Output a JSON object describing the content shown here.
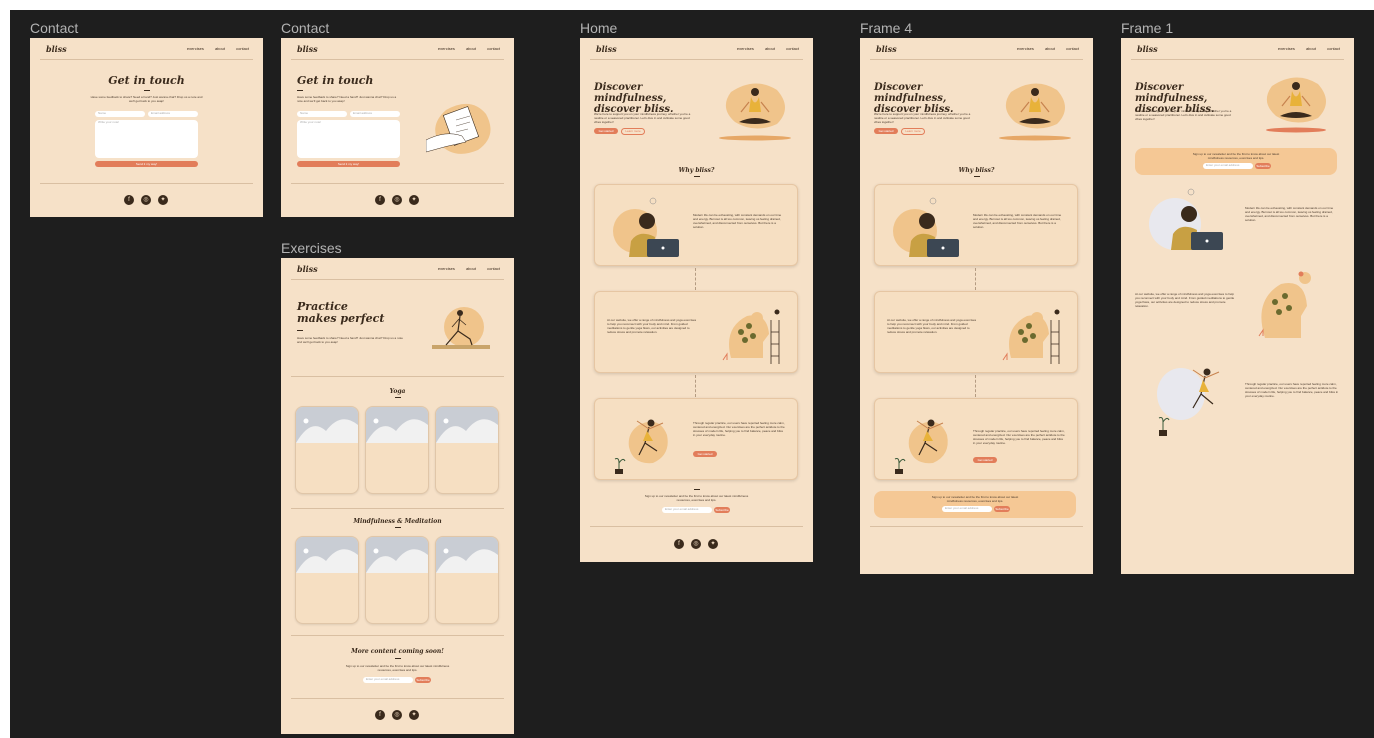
{
  "frames": {
    "contact1": {
      "label": "Contact"
    },
    "contact2": {
      "label": "Contact"
    },
    "exercises": {
      "label": "Exercises"
    },
    "home": {
      "label": "Home"
    },
    "frame4": {
      "label": "Frame 4"
    },
    "frame1": {
      "label": "Frame 1"
    }
  },
  "nav": {
    "logo": "bliss",
    "links": [
      "exercises",
      "about",
      "contact"
    ]
  },
  "contact": {
    "title": "Get in touch",
    "subtitle": "Have some feedback to share? Need a hand? Just wanna chat? Drop us a note and we'll get back to you asap!",
    "name_placeholder": "Name",
    "email_placeholder": "Email address",
    "message_placeholder": "Write your note!",
    "send_label": "Send it my way!"
  },
  "exercises": {
    "title": "Practice makes perfect",
    "subtitle": "Have some feedback to share? Need a hand? Just wanna chat? Drop us a note and we'll get back to you asap!",
    "section1": "Yoga",
    "section2": "Mindfulness & Meditation",
    "coming_soon": "More content coming soon!",
    "newsletter_text": "Sign up to our newsletter and be the first to know about our latest mindfulness resources, exercises and tips.",
    "email_placeholder": "Enter your email address",
    "subscribe_label": "Subscribe"
  },
  "home": {
    "title": "Discover mindfulness, discover bliss.",
    "subtitle": "We're here to support you on your mindfulness journey, whether you're a newbie or a seasoned practitioner. Let's dive in and cultivate some good vibes together!",
    "primary_btn": "Get started",
    "secondary_btn": "Learn more",
    "why_title": "Why bliss?",
    "card1": "Modern life can be exhausting, with constant demands on our time and energy. Burnout is all too common, leaving us feeling drained, overwhelmed, and disconnected from ourselves. But there is a solution.",
    "card2": "At our website, we offer a range of mindfulness and yoga exercises to help you reconnect with your body and mind. From guided meditations to gentle yoga flows, our activities are designed to reduce stress and promote relaxation.",
    "card3": "Through regular practice, our users have reported feeling more calm, centered and energized. Our exercises are the perfect antidote to the stresses of modern life, helping you to find balance, peace and bliss in your everyday routine.",
    "card3_btn": "Get started",
    "newsletter_text": "Sign up to our newsletter and be the first to know about our latest mindfulness resources, exercises and tips.",
    "email_placeholder": "Enter your email address",
    "subscribe_label": "Subscribe"
  },
  "colors": {
    "canvas": "#1e1e1e",
    "frame_bg": "#f6e1c8",
    "accent": "#e27d5a",
    "text": "#3a2a1c",
    "newsletter_bg": "#f5c895"
  },
  "social_icons": [
    "facebook-icon",
    "instagram-icon",
    "twitter-icon"
  ]
}
